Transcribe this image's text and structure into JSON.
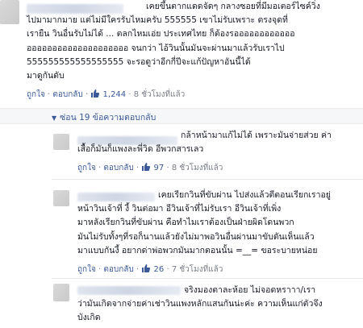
{
  "comment1": {
    "lines": [
      "เคยขึ้นตากแดดจัดๆ กลางซอยที่มีมอเตอร์ไซค์วิ่ง",
      "ไปมามากมาย แต่ไม่มีใครรับไหมครับ 555555 เขาไม่รับเพราะ ตรงจุดที่",
      "เรายืน วินอื่นรับไม่ได้ ... ตลกไหมเอ่ย ประเทศไทย ก็ต้องรออออออออออออ",
      "ออออออออออออออออออออ จนกว่า ไอ้วินนั้นมันจะผ่านมาแล้วรับเราไป",
      "555555555555555555 จะรอดูว่าอีกกี่ปีจะแก้ปัญหาอันนี้ได้",
      "มาดูกันดับ"
    ],
    "like_label": "ถูกใจ",
    "reply_label": "ตอบกลับ",
    "likes": "1,244",
    "time": "8 ชั่วโมงที่แล้ว"
  },
  "replies_toggle": {
    "arrow": "▼",
    "label": "ซ่อน 19 ข้อความตอบกลับ"
  },
  "reply1": {
    "lines": [
      "กล้าหน้ามาแก้ไม่ได้ เพราะมันจ่ายส่วย ค่า",
      "เสื้อก็มันก็แพงละพี่วิด อีพวกสารเลว"
    ],
    "like_label": "ถูกใจ",
    "reply_label": "ตอบกลับ",
    "likes": "97",
    "time": "8 ชั่วโมงที่แล้ว"
  },
  "reply2": {
    "lines": [
      "เคยเรียกวินที่ขับผ่าน ไปส่งแล้วตีตอนเรียกเราอยู่",
      "หน้าวินเจ้าที่ งี้ วินต่อมา อีวินเจ้าที่ไม่รับเรา อีวินเจ้าที่เพิ่ง",
      "มาหลังเรียกวินที่ขับผ่าน คือทำไมเราต้องเป็นฝ่ายผิดโดนพวก",
      "มันไม่รับทั้งๆที่รอก็นานแล้วยังไม่มาพอวินอื่นผ่านมาขับดันเห็นแล้ว",
      "มาแบบกันงี้ อยากด่าพ่อพวกมันมากตอนนั้น =__= ขอระบายหน่อย"
    ],
    "like_label": "ถูกใจ",
    "reply_label": "ตอบกลับ",
    "likes": "26",
    "time": "7 ชั่วโมงที่แล้ว"
  },
  "reply3": {
    "lines": [
      "จริงมองตาละห้อย ไม่จอดหราาา/เรา",
      "ว่ามันเกิดจากจ่ายค่าเช่าวินแพงหลักแสนกันน่ะค่ะ ความเห็นแก่ตัวจึง",
      "บังเกิด"
    ]
  },
  "colors": {
    "link": "#3b5998",
    "meta": "#7b808a",
    "text": "#141823"
  }
}
